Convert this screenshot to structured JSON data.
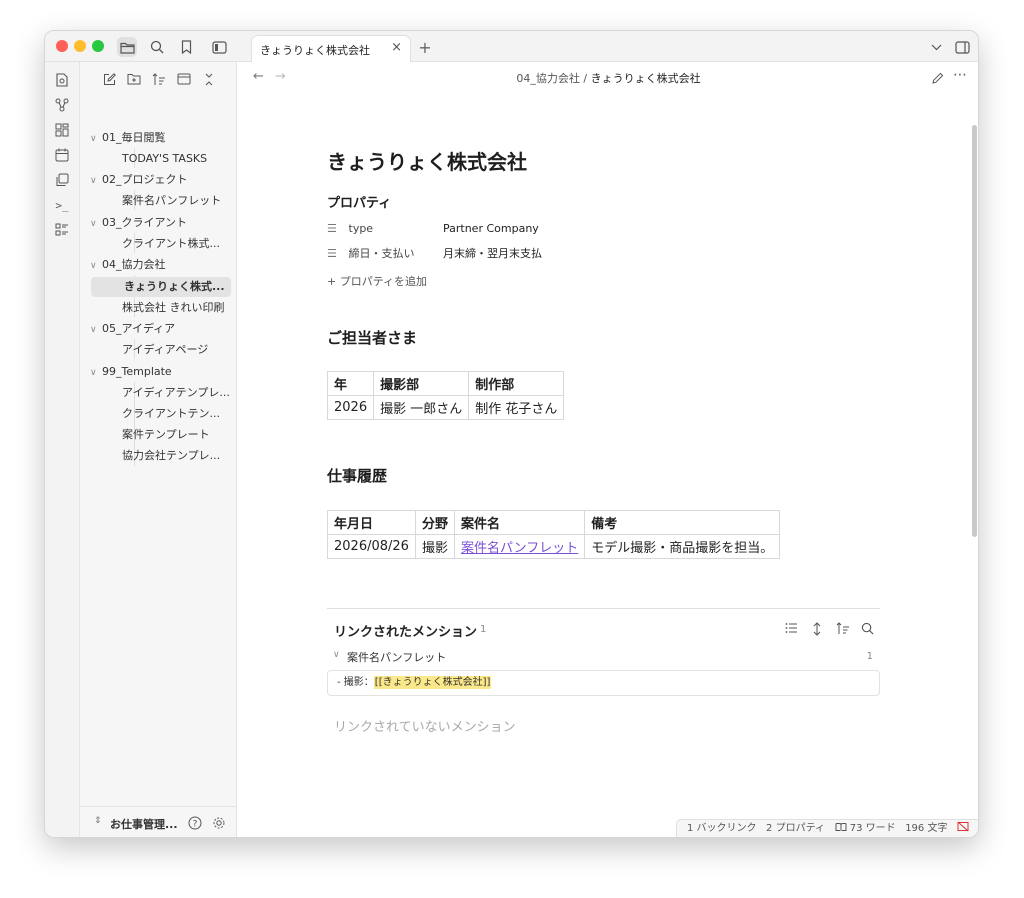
{
  "tab": {
    "title": "きょうりょく株式会社",
    "close": "×",
    "new": "+"
  },
  "titlebar_icons": [
    "folder-icon",
    "search-icon",
    "bookmark-icon",
    "sidebar-toggle-icon"
  ],
  "sidebar": {
    "tree": [
      {
        "type": "folder",
        "label": "01_毎日閲覧"
      },
      {
        "type": "file",
        "label": "TODAY'S TASKS"
      },
      {
        "type": "folder",
        "label": "02_プロジェクト"
      },
      {
        "type": "file",
        "label": "案件名パンフレット"
      },
      {
        "type": "folder",
        "label": "03_クライアント"
      },
      {
        "type": "file",
        "label": "クライアント株式..."
      },
      {
        "type": "folder",
        "label": "04_協力会社"
      },
      {
        "type": "file",
        "label": "きょうりょく株式...",
        "active": true
      },
      {
        "type": "file",
        "label": "株式会社 きれい印刷"
      },
      {
        "type": "folder",
        "label": "05_アイディア"
      },
      {
        "type": "file",
        "label": "アイディアページ"
      },
      {
        "type": "folder",
        "label": "99_Template"
      },
      {
        "type": "file",
        "label": "アイディアテンプレ..."
      },
      {
        "type": "file",
        "label": "クライアントテン..."
      },
      {
        "type": "file",
        "label": "案件テンプレート"
      },
      {
        "type": "file",
        "label": "協力会社テンプレ..."
      }
    ],
    "vault_name": "お仕事管理..."
  },
  "breadcrumb": {
    "folder": "04_協力会社",
    "sep": "/",
    "file": "きょうりょく株式会社"
  },
  "note": {
    "title": "きょうりょく株式会社",
    "properties_heading": "プロパティ",
    "properties": [
      {
        "key": "type",
        "value": "Partner Company"
      },
      {
        "key": "締日・支払い",
        "value": "月末締・翌月末支払"
      }
    ],
    "add_property": "+ プロパティを追加",
    "contacts_heading": "ご担当者さま",
    "contacts_table": {
      "headers": [
        "年",
        "撮影部",
        "制作部"
      ],
      "rows": [
        [
          "2026",
          "撮影 一郎さん",
          "制作 花子さん"
        ]
      ]
    },
    "history_heading": "仕事履歴",
    "history_table": {
      "headers": [
        "年月日",
        "分野",
        "案件名",
        "備考"
      ],
      "rows": [
        [
          "2026/08/26",
          "撮影",
          "案件名パンフレット",
          "モデル撮影・商品撮影を担当。"
        ]
      ]
    }
  },
  "backlinks": {
    "linked_title": "リンクされたメンション",
    "linked_count": "1",
    "group_title": "案件名パンフレット",
    "group_count": "1",
    "snippet_prefix": "- 撮影：",
    "snippet_link": "[[きょうりょく株式会社]]",
    "unlinked_title": "リンクされていないメンション"
  },
  "status": {
    "backlinks": "1 バックリンク",
    "properties": "2 プロパティ",
    "words": "73 ワード",
    "chars": "196 文字"
  },
  "colors": {
    "accent": "#7b4fd6",
    "highlight": "#fbe88a",
    "close": "#fe5f57",
    "minimize": "#febc2e",
    "zoom": "#28c840"
  }
}
